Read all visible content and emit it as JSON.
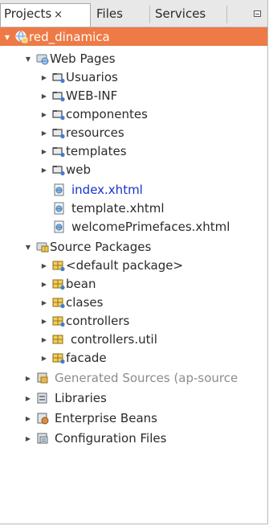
{
  "tabs": [
    {
      "label": "Projects",
      "close": "×",
      "active": true
    },
    {
      "label": "Files",
      "active": false
    },
    {
      "label": "Services",
      "active": false
    }
  ],
  "colors": {
    "selection": "#ee7a45",
    "link": "#1533c9",
    "muted": "#8c8c8c"
  },
  "tree": {
    "root": "red_dinamica",
    "web_pages": {
      "label": "Web Pages",
      "folders": [
        "Usuarios",
        "WEB-INF",
        "componentes",
        "resources",
        "templates",
        "web"
      ],
      "files": [
        "index.xhtml",
        "template.xhtml",
        "welcomePrimefaces.xhtml"
      ]
    },
    "source_packages": {
      "label": "Source Packages",
      "packages": [
        "<default package>",
        "bean",
        "clases",
        "controllers",
        "controllers.util",
        "facade"
      ]
    },
    "generated_sources": "Generated Sources (ap-source",
    "libraries": "Libraries",
    "enterprise_beans": "Enterprise Beans",
    "configuration_files": "Configuration Files"
  }
}
